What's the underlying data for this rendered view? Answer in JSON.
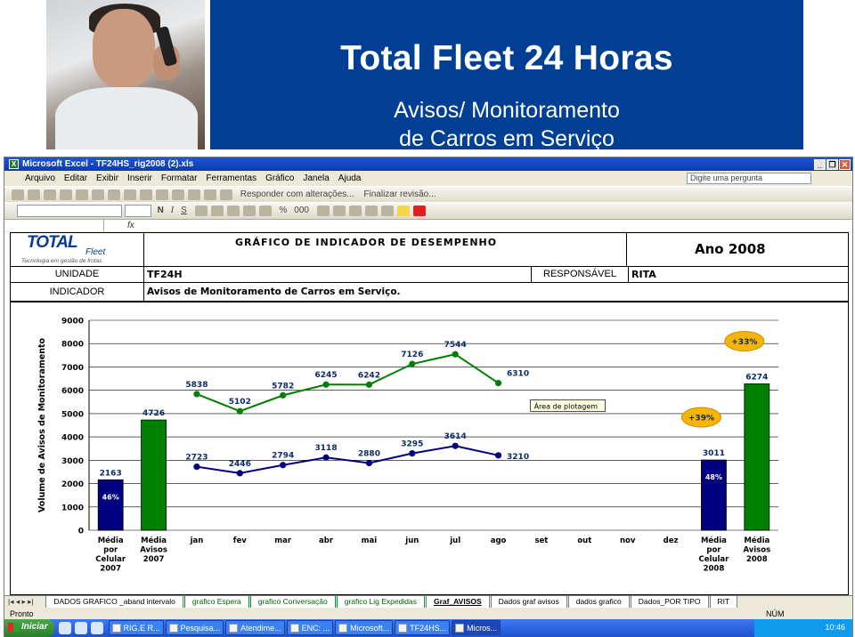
{
  "slide": {
    "title": "Total Fleet 24 Horas",
    "subtitle_line1": "Avisos/ Monitoramento",
    "subtitle_line2": "de Carros em Serviço",
    "banner_color": "#003f93"
  },
  "window": {
    "title": "Microsoft Excel - TF24HS_rig2008 (2).xls",
    "buttons": [
      "_",
      "❐",
      "✕"
    ]
  },
  "menu": [
    "Arquivo",
    "Editar",
    "Exibir",
    "Inserir",
    "Formatar",
    "Ferramentas",
    "Gráfico",
    "Janela",
    "Ajuda"
  ],
  "ask_placeholder": "Digite uma pergunta",
  "toolbar": {
    "reply_label": "Responder com alterações...",
    "finalize_label": "Finalizar revisão...",
    "format_buttons": [
      "N",
      "I",
      "S"
    ],
    "percent": "%",
    "thousands": "000"
  },
  "formula_bar": {
    "fx": "fx"
  },
  "report": {
    "logo_text": "TOTAL",
    "logo_sub": "Fleet",
    "logo_tagline": "Tecnologia em gestão de frotas",
    "header_title": "GRÁFICO DE INDICADOR DE DESEMPENHO",
    "year": "Ano 2008",
    "unidade_label": "UNIDADE",
    "unidade_value": "TF24H",
    "responsavel_label": "RESPONSÁVEL",
    "responsavel_value": "RITA",
    "indicador_label": "INDICADOR",
    "indicador_value": "Avisos de Monitoramento de Carros em Serviço."
  },
  "chart_data": {
    "type": "bar",
    "ylabel": "Volume de Avisos de Monitoramento",
    "ylim": [
      0,
      9000
    ],
    "yticks": [
      0,
      1000,
      2000,
      3000,
      4000,
      5000,
      6000,
      7000,
      8000,
      9000
    ],
    "grid": true,
    "categories": [
      "Média por Celular 2007",
      "Média Avisos 2007",
      "jan",
      "fev",
      "mar",
      "abr",
      "mai",
      "jun",
      "jul",
      "ago",
      "set",
      "out",
      "nov",
      "dez",
      "Média por Celular 2008",
      "Média Avisos 2008"
    ],
    "bars": [
      {
        "category": "Média por Celular 2007",
        "value": 2163,
        "color": "#000080",
        "inner_label": "46%"
      },
      {
        "category": "Média Avisos 2007",
        "value": 4726,
        "color": "#008000"
      },
      {
        "category": "Média por Celular 2008",
        "value": 3011,
        "color": "#000080",
        "inner_label": "48%"
      },
      {
        "category": "Média Avisos 2008",
        "value": 6274,
        "color": "#008000"
      }
    ],
    "series": [
      {
        "color": "#008000",
        "x": [
          "jan",
          "fev",
          "mar",
          "abr",
          "mai",
          "jun",
          "jul",
          "ago"
        ],
        "values": [
          5838,
          5102,
          5782,
          6245,
          6242,
          7126,
          7544,
          6310
        ]
      },
      {
        "color": "#000080",
        "x": [
          "jan",
          "fev",
          "mar",
          "abr",
          "mai",
          "jun",
          "jul",
          "ago"
        ],
        "values": [
          2723,
          2446,
          2794,
          3118,
          2880,
          3295,
          3614,
          3210
        ]
      }
    ],
    "callouts": [
      {
        "text": "+33%",
        "near": "Média Avisos 2008"
      },
      {
        "text": "+39%",
        "near": "Média por Celular 2008"
      }
    ],
    "tooltip": "Área de plotagem"
  },
  "sheet_tabs": [
    {
      "label": "DADOS GRAFICO _aband intervalo",
      "green": false
    },
    {
      "label": "grafico Espera",
      "green": true
    },
    {
      "label": "grafico Conversação",
      "green": true
    },
    {
      "label": "grafico Lig Expedidas",
      "green": true
    },
    {
      "label": "Graf_AVISOS",
      "green": false,
      "active": true
    },
    {
      "label": "Dados graf avisos",
      "green": false
    },
    {
      "label": "dados grafico",
      "green": false
    },
    {
      "label": "Dados_POR TIPO",
      "green": false
    },
    {
      "label": "RIT",
      "green": false
    }
  ],
  "status": {
    "left": "Pronto",
    "num": "NÚM"
  },
  "taskbar": {
    "start": "Iniciar",
    "tasks": [
      "RIG.E R...",
      "Pesquisa...",
      "Atendime...",
      "ENC: ...",
      "Microsoft...",
      "TF24HS...",
      "Micros..."
    ],
    "active_task": 6,
    "clock": "10:46"
  }
}
